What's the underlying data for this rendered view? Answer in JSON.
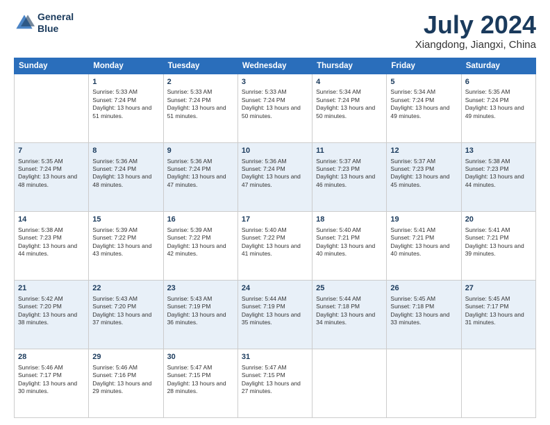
{
  "header": {
    "logo_line1": "General",
    "logo_line2": "Blue",
    "month": "July 2024",
    "location": "Xiangdong, Jiangxi, China"
  },
  "days_of_week": [
    "Sunday",
    "Monday",
    "Tuesday",
    "Wednesday",
    "Thursday",
    "Friday",
    "Saturday"
  ],
  "weeks": [
    [
      {
        "day": "",
        "sunrise": "",
        "sunset": "",
        "daylight": ""
      },
      {
        "day": "1",
        "sunrise": "Sunrise: 5:33 AM",
        "sunset": "Sunset: 7:24 PM",
        "daylight": "Daylight: 13 hours and 51 minutes."
      },
      {
        "day": "2",
        "sunrise": "Sunrise: 5:33 AM",
        "sunset": "Sunset: 7:24 PM",
        "daylight": "Daylight: 13 hours and 51 minutes."
      },
      {
        "day": "3",
        "sunrise": "Sunrise: 5:33 AM",
        "sunset": "Sunset: 7:24 PM",
        "daylight": "Daylight: 13 hours and 50 minutes."
      },
      {
        "day": "4",
        "sunrise": "Sunrise: 5:34 AM",
        "sunset": "Sunset: 7:24 PM",
        "daylight": "Daylight: 13 hours and 50 minutes."
      },
      {
        "day": "5",
        "sunrise": "Sunrise: 5:34 AM",
        "sunset": "Sunset: 7:24 PM",
        "daylight": "Daylight: 13 hours and 49 minutes."
      },
      {
        "day": "6",
        "sunrise": "Sunrise: 5:35 AM",
        "sunset": "Sunset: 7:24 PM",
        "daylight": "Daylight: 13 hours and 49 minutes."
      }
    ],
    [
      {
        "day": "7",
        "sunrise": "Sunrise: 5:35 AM",
        "sunset": "Sunset: 7:24 PM",
        "daylight": "Daylight: 13 hours and 48 minutes."
      },
      {
        "day": "8",
        "sunrise": "Sunrise: 5:36 AM",
        "sunset": "Sunset: 7:24 PM",
        "daylight": "Daylight: 13 hours and 48 minutes."
      },
      {
        "day": "9",
        "sunrise": "Sunrise: 5:36 AM",
        "sunset": "Sunset: 7:24 PM",
        "daylight": "Daylight: 13 hours and 47 minutes."
      },
      {
        "day": "10",
        "sunrise": "Sunrise: 5:36 AM",
        "sunset": "Sunset: 7:24 PM",
        "daylight": "Daylight: 13 hours and 47 minutes."
      },
      {
        "day": "11",
        "sunrise": "Sunrise: 5:37 AM",
        "sunset": "Sunset: 7:23 PM",
        "daylight": "Daylight: 13 hours and 46 minutes."
      },
      {
        "day": "12",
        "sunrise": "Sunrise: 5:37 AM",
        "sunset": "Sunset: 7:23 PM",
        "daylight": "Daylight: 13 hours and 45 minutes."
      },
      {
        "day": "13",
        "sunrise": "Sunrise: 5:38 AM",
        "sunset": "Sunset: 7:23 PM",
        "daylight": "Daylight: 13 hours and 44 minutes."
      }
    ],
    [
      {
        "day": "14",
        "sunrise": "Sunrise: 5:38 AM",
        "sunset": "Sunset: 7:23 PM",
        "daylight": "Daylight: 13 hours and 44 minutes."
      },
      {
        "day": "15",
        "sunrise": "Sunrise: 5:39 AM",
        "sunset": "Sunset: 7:22 PM",
        "daylight": "Daylight: 13 hours and 43 minutes."
      },
      {
        "day": "16",
        "sunrise": "Sunrise: 5:39 AM",
        "sunset": "Sunset: 7:22 PM",
        "daylight": "Daylight: 13 hours and 42 minutes."
      },
      {
        "day": "17",
        "sunrise": "Sunrise: 5:40 AM",
        "sunset": "Sunset: 7:22 PM",
        "daylight": "Daylight: 13 hours and 41 minutes."
      },
      {
        "day": "18",
        "sunrise": "Sunrise: 5:40 AM",
        "sunset": "Sunset: 7:21 PM",
        "daylight": "Daylight: 13 hours and 40 minutes."
      },
      {
        "day": "19",
        "sunrise": "Sunrise: 5:41 AM",
        "sunset": "Sunset: 7:21 PM",
        "daylight": "Daylight: 13 hours and 40 minutes."
      },
      {
        "day": "20",
        "sunrise": "Sunrise: 5:41 AM",
        "sunset": "Sunset: 7:21 PM",
        "daylight": "Daylight: 13 hours and 39 minutes."
      }
    ],
    [
      {
        "day": "21",
        "sunrise": "Sunrise: 5:42 AM",
        "sunset": "Sunset: 7:20 PM",
        "daylight": "Daylight: 13 hours and 38 minutes."
      },
      {
        "day": "22",
        "sunrise": "Sunrise: 5:43 AM",
        "sunset": "Sunset: 7:20 PM",
        "daylight": "Daylight: 13 hours and 37 minutes."
      },
      {
        "day": "23",
        "sunrise": "Sunrise: 5:43 AM",
        "sunset": "Sunset: 7:19 PM",
        "daylight": "Daylight: 13 hours and 36 minutes."
      },
      {
        "day": "24",
        "sunrise": "Sunrise: 5:44 AM",
        "sunset": "Sunset: 7:19 PM",
        "daylight": "Daylight: 13 hours and 35 minutes."
      },
      {
        "day": "25",
        "sunrise": "Sunrise: 5:44 AM",
        "sunset": "Sunset: 7:18 PM",
        "daylight": "Daylight: 13 hours and 34 minutes."
      },
      {
        "day": "26",
        "sunrise": "Sunrise: 5:45 AM",
        "sunset": "Sunset: 7:18 PM",
        "daylight": "Daylight: 13 hours and 33 minutes."
      },
      {
        "day": "27",
        "sunrise": "Sunrise: 5:45 AM",
        "sunset": "Sunset: 7:17 PM",
        "daylight": "Daylight: 13 hours and 31 minutes."
      }
    ],
    [
      {
        "day": "28",
        "sunrise": "Sunrise: 5:46 AM",
        "sunset": "Sunset: 7:17 PM",
        "daylight": "Daylight: 13 hours and 30 minutes."
      },
      {
        "day": "29",
        "sunrise": "Sunrise: 5:46 AM",
        "sunset": "Sunset: 7:16 PM",
        "daylight": "Daylight: 13 hours and 29 minutes."
      },
      {
        "day": "30",
        "sunrise": "Sunrise: 5:47 AM",
        "sunset": "Sunset: 7:15 PM",
        "daylight": "Daylight: 13 hours and 28 minutes."
      },
      {
        "day": "31",
        "sunrise": "Sunrise: 5:47 AM",
        "sunset": "Sunset: 7:15 PM",
        "daylight": "Daylight: 13 hours and 27 minutes."
      },
      {
        "day": "",
        "sunrise": "",
        "sunset": "",
        "daylight": ""
      },
      {
        "day": "",
        "sunrise": "",
        "sunset": "",
        "daylight": ""
      },
      {
        "day": "",
        "sunrise": "",
        "sunset": "",
        "daylight": ""
      }
    ]
  ]
}
